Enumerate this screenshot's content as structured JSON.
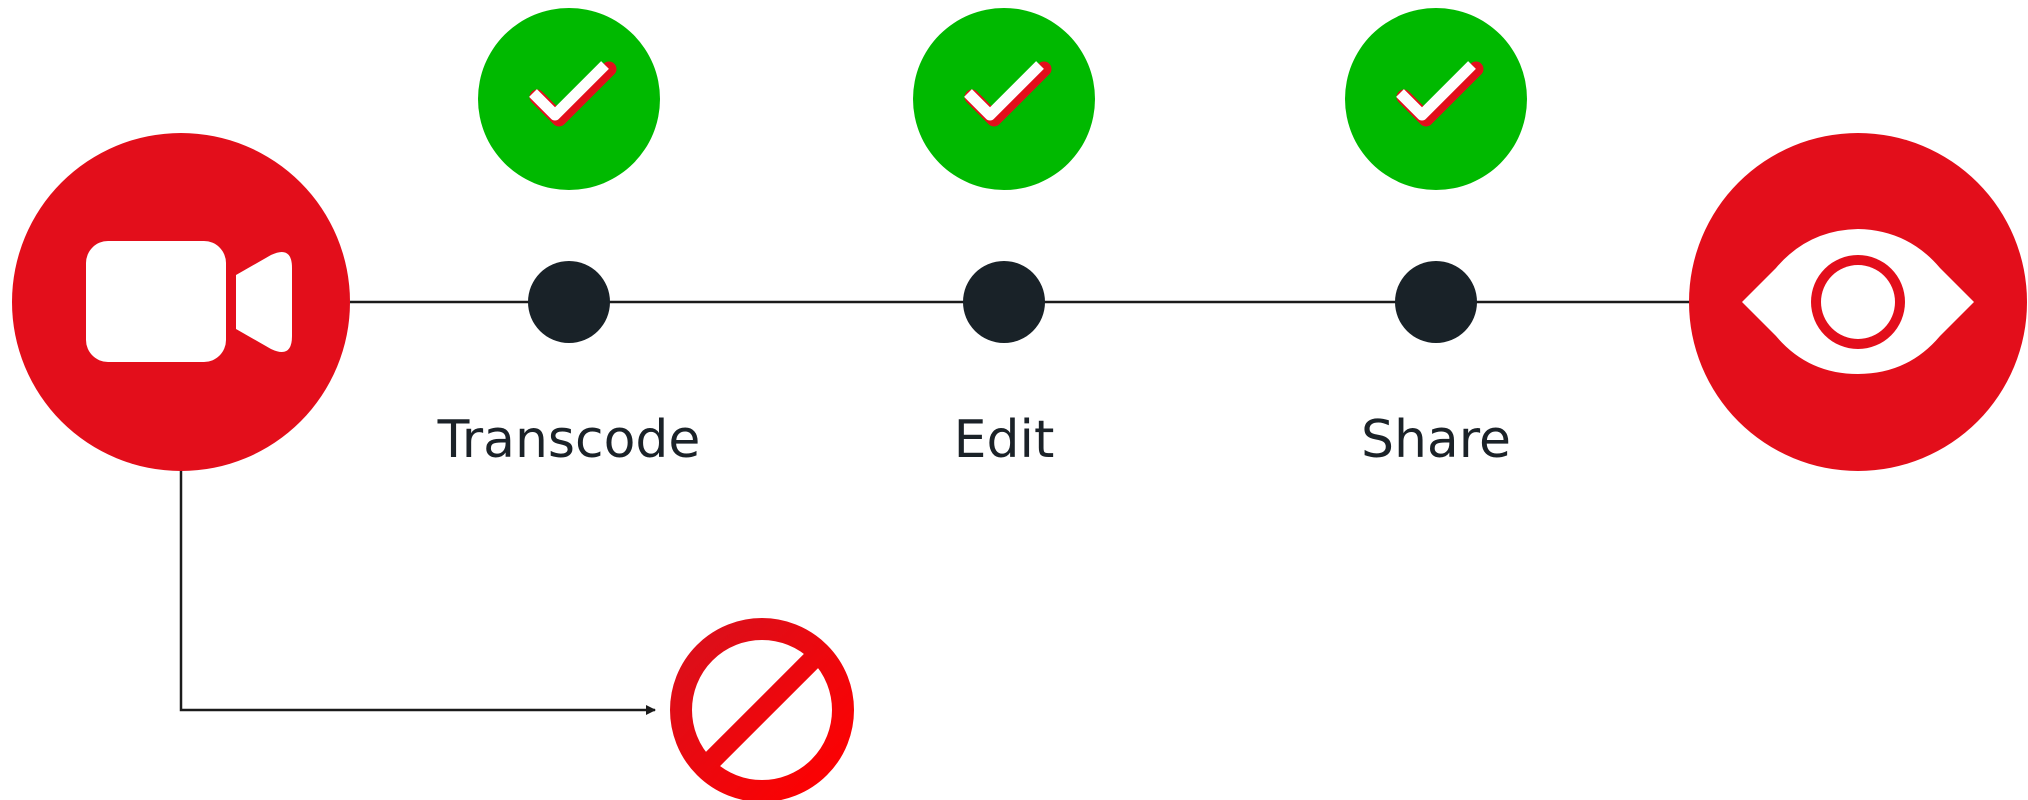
{
  "diagram": {
    "source": {
      "icon": "video-camera-icon",
      "color": "#e30e1b"
    },
    "destination": {
      "icon": "eye-icon",
      "color": "#e30e1b"
    },
    "steps": [
      {
        "label": "Transcode",
        "status": "check-icon",
        "status_color": "#00b900"
      },
      {
        "label": "Edit",
        "status": "check-icon",
        "status_color": "#00b900"
      },
      {
        "label": "Share",
        "status": "check-icon",
        "status_color": "#00b900"
      }
    ],
    "failure_branch": {
      "icon": "prohibited-icon",
      "color": "#ea0b15"
    },
    "colors": {
      "node": "#192228",
      "line": "#1b1b1b",
      "check_white": "#ffffff",
      "check_red": "#e30e1b"
    }
  }
}
